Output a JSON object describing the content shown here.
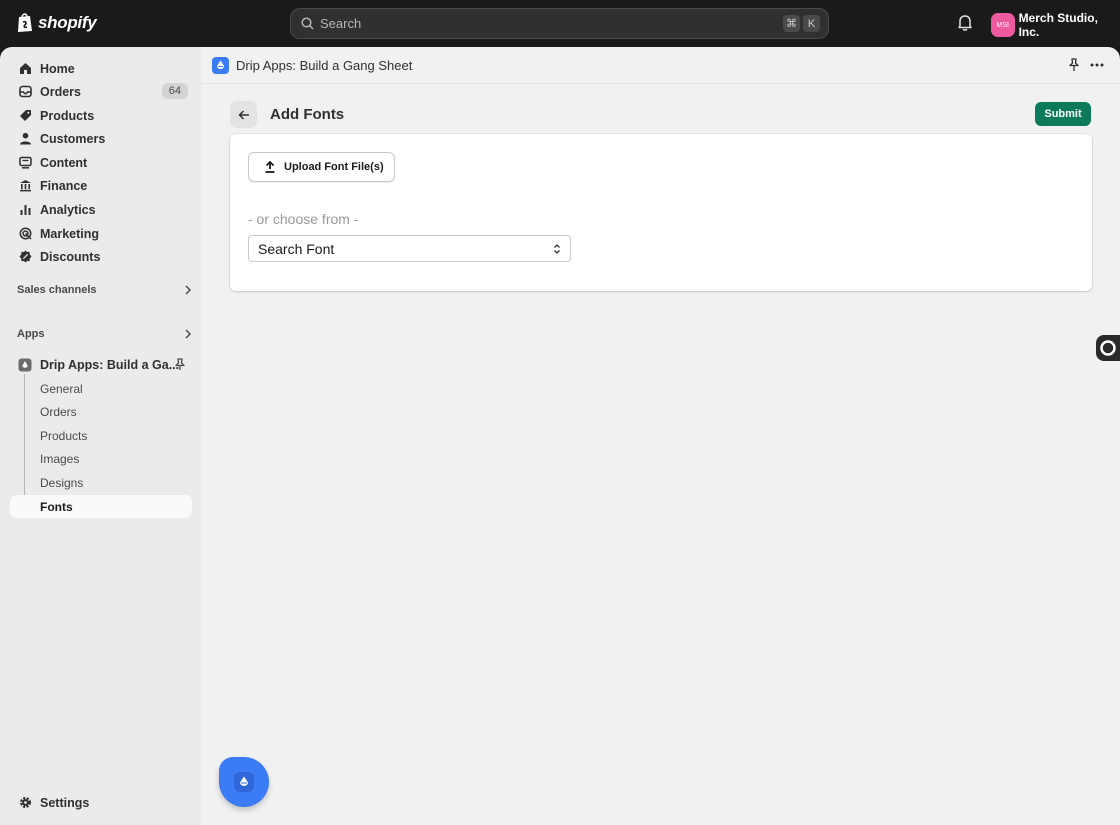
{
  "topbar": {
    "brand": "shopify",
    "search_placeholder": "Search",
    "shortcut_key1": "⌘",
    "shortcut_key2": "K",
    "store_initials": "MSI",
    "store_name": "Merch Studio, Inc."
  },
  "sidebar": {
    "items": [
      {
        "label": "Home",
        "icon": "home-icon"
      },
      {
        "label": "Orders",
        "icon": "orders-icon",
        "badge": "64"
      },
      {
        "label": "Products",
        "icon": "tag-icon"
      },
      {
        "label": "Customers",
        "icon": "person-icon"
      },
      {
        "label": "Content",
        "icon": "content-icon"
      },
      {
        "label": "Finance",
        "icon": "bank-icon"
      },
      {
        "label": "Analytics",
        "icon": "bar-chart-icon"
      },
      {
        "label": "Marketing",
        "icon": "target-icon"
      },
      {
        "label": "Discounts",
        "icon": "discount-icon"
      }
    ],
    "sales_channels_label": "Sales channels",
    "apps_label": "Apps",
    "app_name": "Drip Apps: Build a Ga...",
    "app_subitems": [
      "General",
      "Orders",
      "Products",
      "Images",
      "Designs",
      "Fonts"
    ],
    "active_subitem": "Fonts",
    "settings_label": "Settings"
  },
  "main": {
    "app_title": "Drip Apps: Build a Gang Sheet",
    "page_title": "Add Fonts",
    "submit_label": "Submit",
    "upload_label": "Upload Font File(s)",
    "choose_text": "- or choose from -",
    "select_value": "Search Font"
  },
  "colors": {
    "accent_green": "#0c7a5b",
    "app_blue": "#3b7bf5",
    "avatar_pink": "#ee5aa0"
  }
}
